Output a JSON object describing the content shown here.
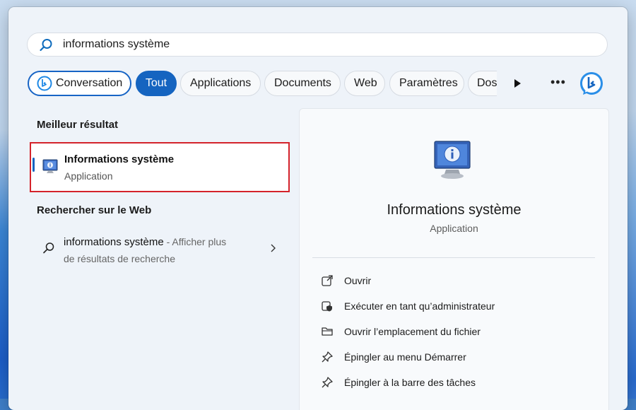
{
  "search": {
    "query": "informations système"
  },
  "filters": {
    "conversation": "Conversation",
    "all": "Tout",
    "apps": "Applications",
    "docs": "Documents",
    "web": "Web",
    "settings": "Paramètres",
    "folders_truncated": "Dos"
  },
  "best": {
    "heading": "Meilleur résultat",
    "title": "Informations système",
    "subtitle": "Application"
  },
  "web_search": {
    "heading": "Rechercher sur le Web",
    "query": "informations système",
    "hint": " - Afficher plus",
    "hint2": "de résultats de recherche"
  },
  "detail": {
    "title": "Informations système",
    "subtitle": "Application",
    "actions": [
      {
        "label": "Ouvrir",
        "icon": "open-external-icon"
      },
      {
        "label": "Exécuter en tant qu’administrateur",
        "icon": "shield-icon"
      },
      {
        "label": "Ouvrir l’emplacement du fichier",
        "icon": "folder-icon"
      },
      {
        "label": "Épingler au menu Démarrer",
        "icon": "pin-icon"
      },
      {
        "label": "Épingler à la barre des tâches",
        "icon": "pin-icon"
      }
    ]
  },
  "colors": {
    "accent": "#1564c0",
    "highlight_border": "#d4232b"
  }
}
